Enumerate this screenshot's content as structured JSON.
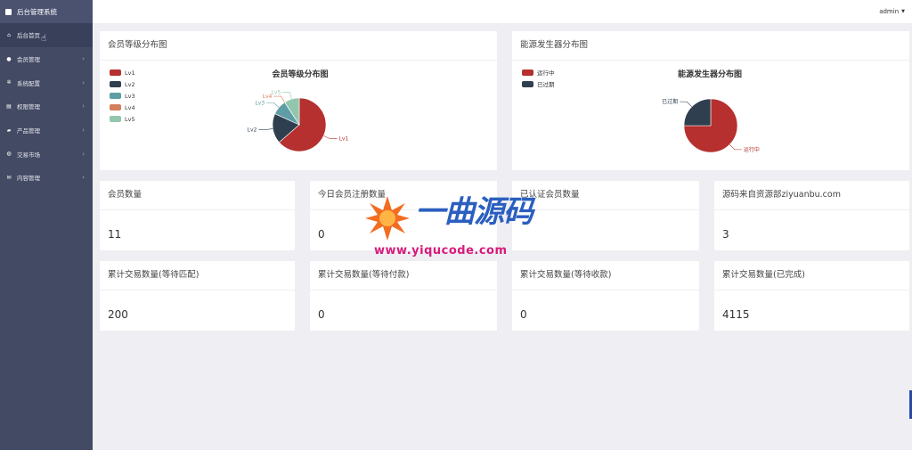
{
  "app": {
    "title": "后台管理系统"
  },
  "topbar": {
    "user": "admin"
  },
  "menu": {
    "items": [
      {
        "label": "后台首页",
        "icon": "home-icon",
        "glyph": "⌂"
      },
      {
        "label": "会员管理",
        "icon": "user-icon",
        "glyph": "●"
      },
      {
        "label": "系统配置",
        "icon": "cogs-icon",
        "glyph": "✲"
      },
      {
        "label": "权限管理",
        "icon": "list-icon",
        "glyph": "▤"
      },
      {
        "label": "产品管理",
        "icon": "folder-icon",
        "glyph": "▰"
      },
      {
        "label": "交易市场",
        "icon": "globe-icon",
        "glyph": "◍"
      },
      {
        "label": "内容管理",
        "icon": "envelope-icon",
        "glyph": "✉"
      }
    ]
  },
  "charts": {
    "member": {
      "panel_title": "会员等级分布图"
    },
    "energy": {
      "panel_title": "能源发生器分布图"
    }
  },
  "chart_data": [
    {
      "type": "pie",
      "title": "会员等级分布图",
      "categories": [
        "Lv1",
        "Lv2",
        "Lv3",
        "Lv4",
        "Lv5"
      ],
      "values": [
        7,
        2,
        1,
        0.01,
        1
      ],
      "colors": [
        "#b5302e",
        "#2f3f4f",
        "#5f9ea6",
        "#d67f5d",
        "#93c7ad"
      ],
      "legend": "top-left"
    },
    {
      "type": "pie",
      "title": "能源发生器分布图",
      "categories": [
        "运行中",
        "已过期"
      ],
      "values": [
        75,
        25
      ],
      "colors": [
        "#b5302e",
        "#2f3f4f"
      ],
      "legend": "top-left"
    }
  ],
  "stats": [
    {
      "label": "会员数量",
      "value": "11"
    },
    {
      "label": "今日会员注册数量",
      "value": "0"
    },
    {
      "label": "已认证会员数量",
      "value": ""
    },
    {
      "label": "源码来自资源部ziyuanbu.com",
      "value": "3"
    },
    {
      "label": "累计交易数量(等待匹配)",
      "value": "200"
    },
    {
      "label": "累计交易数量(等待付款)",
      "value": "0"
    },
    {
      "label": "累计交易数量(等待收款)",
      "value": "0"
    },
    {
      "label": "累计交易数量(已完成)",
      "value": "4115"
    }
  ],
  "watermark": {
    "cn": "一曲源码",
    "url": "www.yiqucode.com"
  }
}
